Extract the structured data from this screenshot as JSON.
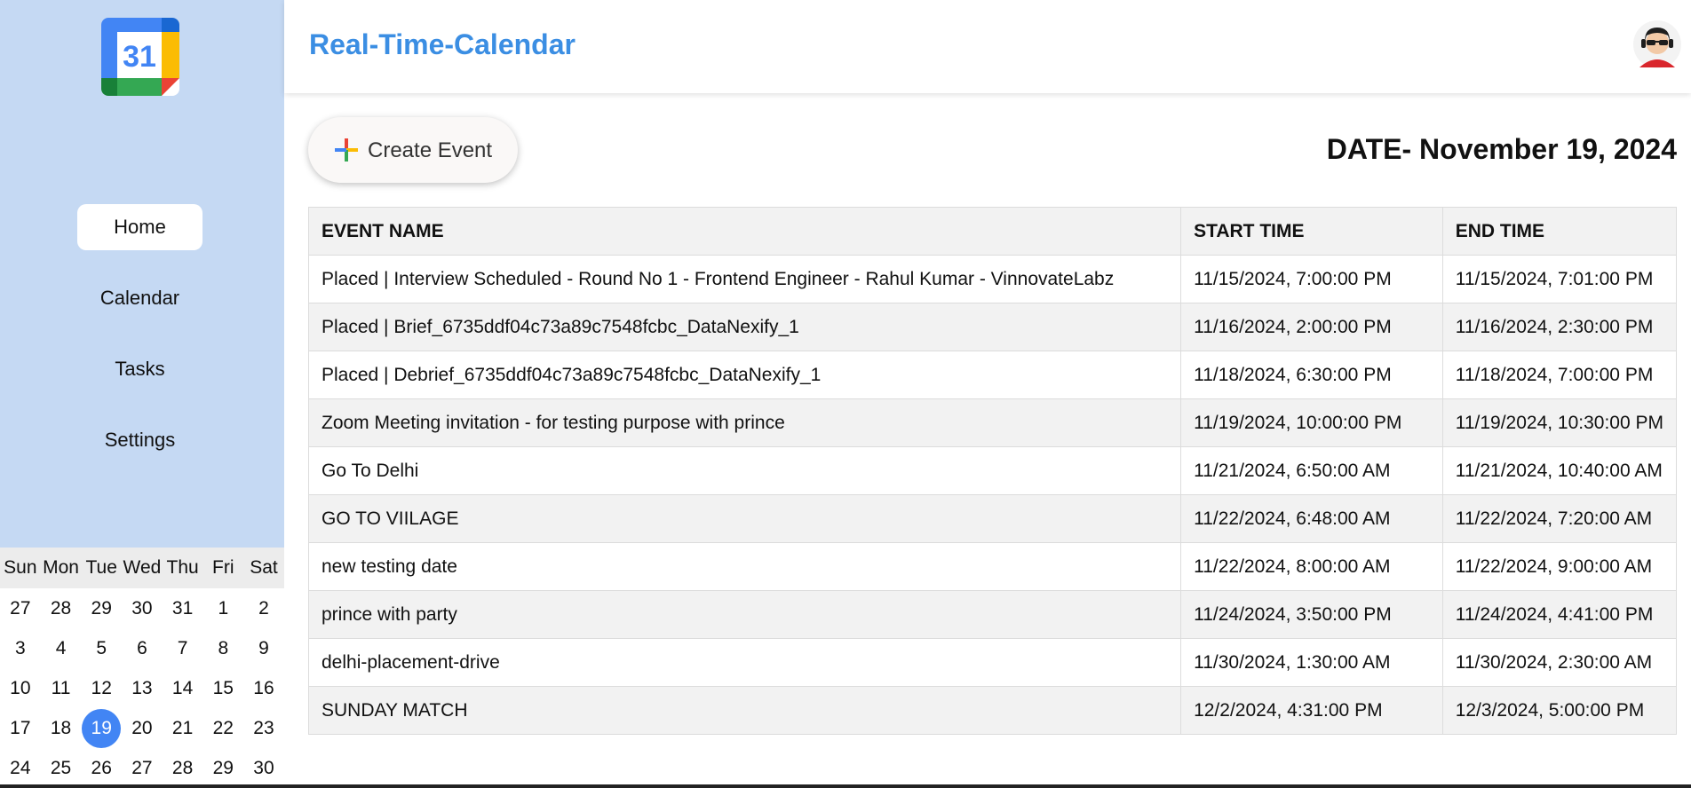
{
  "app": {
    "title": "Real-Time-Calendar",
    "logo_text": "31"
  },
  "sidebar": {
    "items": [
      {
        "label": "Home",
        "active": true
      },
      {
        "label": "Calendar",
        "active": false
      },
      {
        "label": "Tasks",
        "active": false
      },
      {
        "label": "Settings",
        "active": false
      }
    ]
  },
  "mini_calendar": {
    "weekdays": [
      "Sun",
      "Mon",
      "Tue",
      "Wed",
      "Thu",
      "Fri",
      "Sat"
    ],
    "days": [
      "27",
      "28",
      "29",
      "30",
      "31",
      "1",
      "2",
      "3",
      "4",
      "5",
      "6",
      "7",
      "8",
      "9",
      "10",
      "11",
      "12",
      "13",
      "14",
      "15",
      "16",
      "17",
      "18",
      "19",
      "20",
      "21",
      "22",
      "23",
      "24",
      "25",
      "26",
      "27",
      "28",
      "29",
      "30"
    ],
    "today": "19"
  },
  "toolbar": {
    "create_label": "Create Event"
  },
  "date_heading": "DATE- November 19, 2024",
  "table": {
    "headers": [
      "EVENT NAME",
      "START TIME",
      "END TIME"
    ],
    "rows": [
      [
        "Placed | Interview Scheduled - Round No 1 - Frontend Engineer - Rahul Kumar - VinnovateLabz",
        "11/15/2024, 7:00:00 PM",
        "11/15/2024, 7:01:00 PM"
      ],
      [
        "Placed | Brief_6735ddf04c73a89c7548fcbc_DataNexify_1",
        "11/16/2024, 2:00:00 PM",
        "11/16/2024, 2:30:00 PM"
      ],
      [
        "Placed | Debrief_6735ddf04c73a89c7548fcbc_DataNexify_1",
        "11/18/2024, 6:30:00 PM",
        "11/18/2024, 7:00:00 PM"
      ],
      [
        "Zoom Meeting invitation - for testing purpose with prince",
        "11/19/2024, 10:00:00 PM",
        "11/19/2024, 10:30:00 PM"
      ],
      [
        "Go To Delhi",
        "11/21/2024, 6:50:00 AM",
        "11/21/2024, 10:40:00 AM"
      ],
      [
        "GO TO VIILAGE",
        "11/22/2024, 6:48:00 AM",
        "11/22/2024, 7:20:00 AM"
      ],
      [
        "new testing date",
        "11/22/2024, 8:00:00 AM",
        "11/22/2024, 9:00:00 AM"
      ],
      [
        "prince with party",
        "11/24/2024, 3:50:00 PM",
        "11/24/2024, 4:41:00 PM"
      ],
      [
        "delhi-placement-drive",
        "11/30/2024, 1:30:00 AM",
        "11/30/2024, 2:30:00 AM"
      ],
      [
        "SUNDAY MATCH",
        "12/2/2024, 4:31:00 PM",
        "12/3/2024, 5:00:00 PM"
      ]
    ]
  },
  "colors": {
    "sidebar_bg": "#c5d9f3",
    "accent": "#4285f4",
    "title": "#3b8ee3"
  },
  "icons": {
    "logo": "google-calendar-icon",
    "avatar": "user-avatar-icon",
    "create": "plus-icon"
  }
}
